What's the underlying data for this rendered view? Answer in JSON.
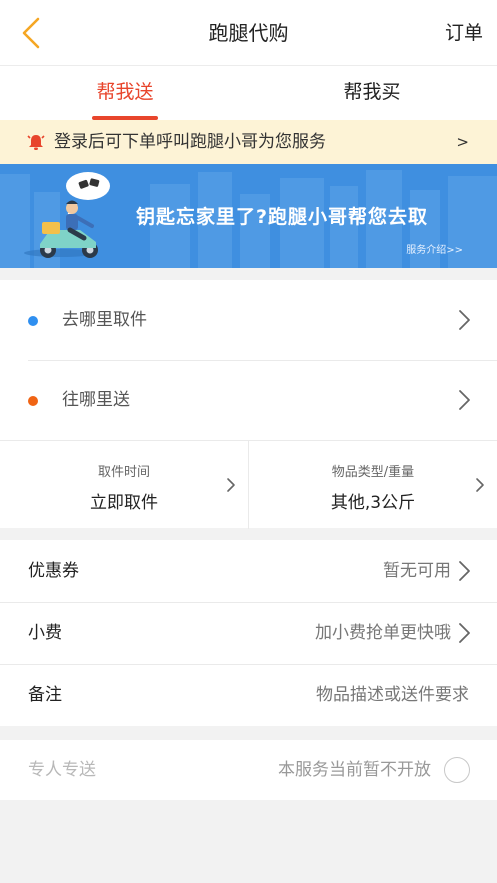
{
  "header": {
    "title": "跑腿代购",
    "orders_label": "订单"
  },
  "tabs": [
    {
      "label": "帮我送",
      "active": true
    },
    {
      "label": "帮我买",
      "active": false
    }
  ],
  "notice": {
    "text": "登录后可下单呼叫跑腿小哥为您服务",
    "arrow": ">"
  },
  "banner": {
    "slogan": "钥匙忘家里了?跑腿小哥帮您去取",
    "intro_link": "服务介绍>>"
  },
  "address": {
    "pickup_label": "去哪里取件",
    "dropoff_label": "往哪里送"
  },
  "pickup": {
    "time_title": "取件时间",
    "time_value": "立即取件",
    "item_title": "物品类型/重量",
    "item_value": "其他,3公斤"
  },
  "options": {
    "coupon_label": "优惠券",
    "coupon_value": "暂无可用",
    "tip_label": "小费",
    "tip_value": "加小费抢单更快哦",
    "remark_label": "备注",
    "remark_value": "物品描述或送件要求"
  },
  "special": {
    "label": "专人专送",
    "value": "本服务当前暂不开放"
  },
  "colors": {
    "accent": "#e8452c",
    "back_arrow": "#f5a623",
    "pickup_dot": "#2f8ff0",
    "dropoff_dot": "#f06414",
    "banner_bg": "#3f8fe0",
    "notice_bg": "#fdf3d6"
  }
}
